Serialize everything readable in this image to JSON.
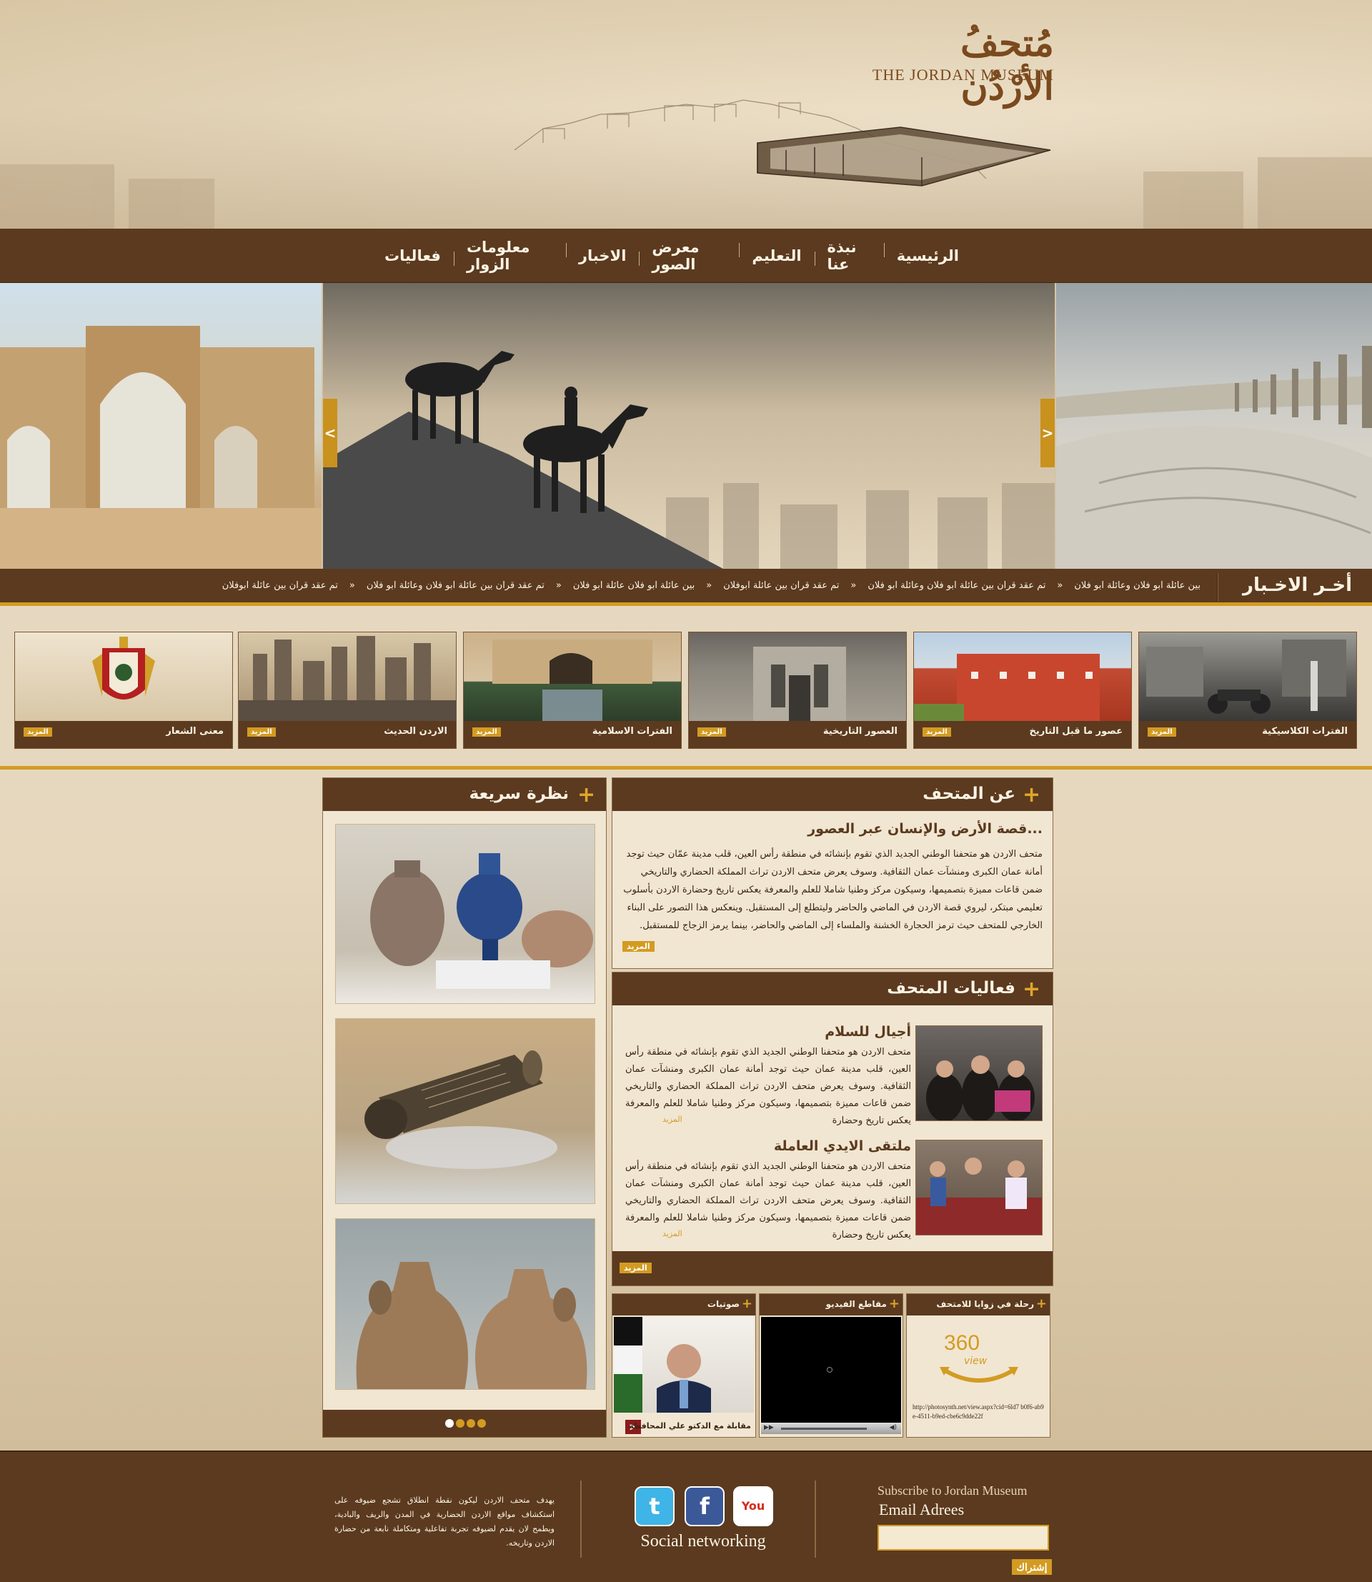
{
  "brand": {
    "logo_ar": "مُتحفُ الأرْدُن",
    "logo_en": "THE JORDAN MUSEUM"
  },
  "nav": {
    "items": [
      "الرئيسية",
      "نبذة عنا",
      "التعليم",
      "معرض الصور",
      "الاخبار",
      "معلومات الزوار",
      "فعاليات"
    ]
  },
  "slider": {
    "prev_label": "<",
    "next_label": ">"
  },
  "ticker": {
    "title": "أخـر الاخـبار",
    "items": [
      "بين عائلة ابو فلان وعائلة ابو فلان",
      "تم عقد قران بين عائلة ابو فلان وعائلة ابو فلان",
      "تم عقد قران بين عائلة ابوفلان",
      "بين عائلة ابو فلان عائلة ابو فلان",
      "تم عقد قران بين عائلة ابو فلان وعائلة ابو فلان",
      "تم عقد قران بين عائلة ابوفلان"
    ],
    "separator": "»"
  },
  "categories": {
    "more_label": "المزيد",
    "items": [
      {
        "label": "الفترات الكلاسيكية"
      },
      {
        "label": "عصور ما قبل التاريخ"
      },
      {
        "label": "العصور التاريخية"
      },
      {
        "label": "الفترات الاسلامية"
      },
      {
        "label": "الاردن الحديث"
      },
      {
        "label": "معنى الشعار"
      }
    ]
  },
  "quick_look": {
    "title": "نظرة سريعة",
    "dots": 4
  },
  "about": {
    "title": "عن المتحف",
    "subtitle": "قصة الأرض والإنسان عبر العصور...",
    "text": "متحف الاردن هو متحفنا الوطني الجديد الذي تقوم بإنشائه في منطقة رأس العين، قلب مدينة عمّان حيث توجد أمانة عمان الكبرى ومنشآت عمان الثقافية. وسوف يعرض متحف الاردن تراث المملكة الحضاري والتاريخي ضمن قاعات مميزة بتصميمها، وسيكون مركز وطنيا شاملا للعلم والمعرفة يعكس تاريخ وحضارة الاردن بأسلوب تعليمي مبتكر، ليروي قصة الاردن في الماضي والحاضر وليتطلع إلى المستقبل. وينعكس هذا التصور على البناء الخارجي للمتحف حيث ترمز الحجارة الخشنة والملساء إلى الماضي والحاضر، بينما يرمز الزجاج للمستقبل.",
    "more_label": "المزيد"
  },
  "events": {
    "title": "فعاليات المتحف",
    "items": [
      {
        "title": "أجيال للسلام",
        "text": "متحف الاردن هو متحفنا الوطني الجديد الذي تقوم بإنشائه في منطقة رأس العين، قلب مدينة عمان حيث توجد أمانة عمان الكبرى ومنشآت عمان الثقافية. وسوف يعرض متحف الاردن تراث المملكة الحضاري والتاريخي ضمن قاعات مميزة بتصميمها، وسيكون مركز وطنيا شاملا للعلم والمعرفة يعكس تاريخ وحضارة",
        "more_label": "المزيد"
      },
      {
        "title": "ملتقى الايدي العاملة",
        "text": "متحف الاردن هو متحفنا الوطني الجديد الذي تقوم بإنشائه في منطقة رأس العين، قلب مدينة عمان حيث توجد أمانة عمان الكبرى ومنشآت عمان الثقافية. وسوف يعرض متحف الاردن تراث المملكة الحضاري والتاريخي ضمن قاعات مميزة بتصميمها، وسيكون مركز وطنيا شاملا للعلم والمعرفة يعكس تاريخ وحضارة",
        "more_label": "المزيد"
      }
    ],
    "more_label": "المزيد"
  },
  "mini_panels": {
    "audio": {
      "title": "صوتيات",
      "caption": "مقابلة مع الدكتو علي المحافظة"
    },
    "video": {
      "title": "مقاطع الفيديو"
    },
    "tour": {
      "title": "رحلة في زوايا للامتحف",
      "badge_number": "360",
      "badge_word": "view",
      "url": "http://photosynth.net/view.aspx?cid=6ld7 b0f6-ab9e-4511-b9ed-cbe6c9dde22f"
    }
  },
  "footer": {
    "about": "يهدف متحف الاردن ليكون نقطة انطلاق تشجع ضيوفه على استكشاف مواقع الاردن الحضارية في المدن والريف والبادية، ويطمح لان يقدم لضيوفه تجربة تفاعلية ومتكاملة نابعة من حضارة الاردن وتاريخه.",
    "social_label": "Social networking",
    "social": [
      {
        "name": "twitter",
        "glyph": "t",
        "color": "#3fb4e6"
      },
      {
        "name": "facebook",
        "glyph": "f",
        "color": "#3b5998"
      },
      {
        "name": "youtube",
        "glyph": "You",
        "color": "#d52b1e"
      }
    ],
    "subscribe_title": "Subscribe to Jordan Museum",
    "email_label": "Email Adrees",
    "email_value": "",
    "subscribe_button": "إشتراك"
  }
}
